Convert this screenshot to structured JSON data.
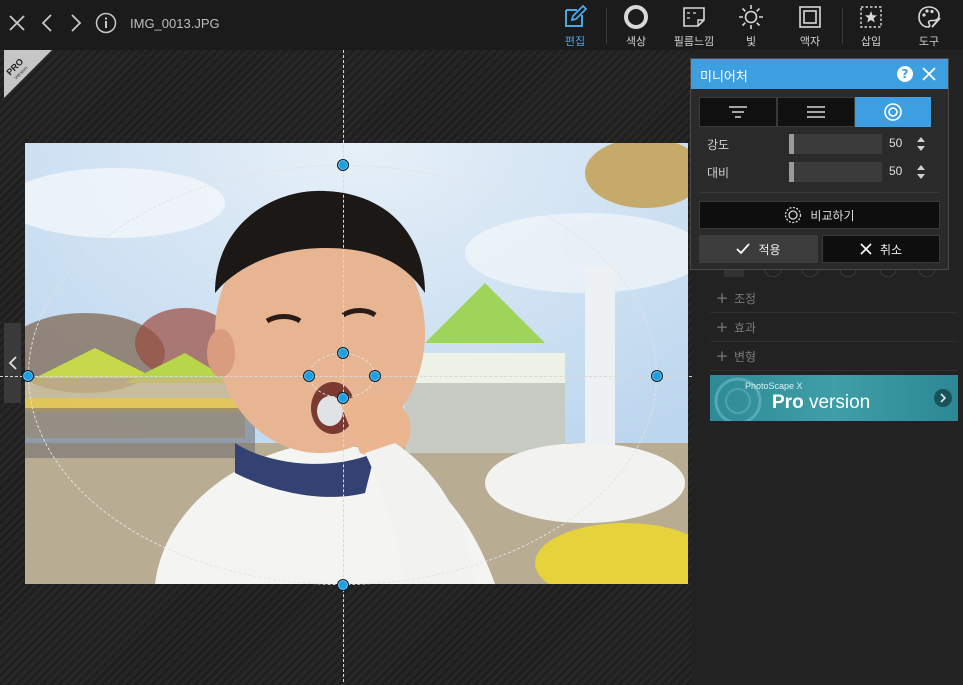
{
  "file": {
    "name": "IMG_0013.JPG"
  },
  "toolbar": {
    "tools": [
      {
        "label": "편집",
        "icon": "edit-icon"
      },
      {
        "label": "색상",
        "icon": "circle-icon"
      },
      {
        "label": "필름느낌",
        "icon": "film-icon"
      },
      {
        "label": "빛",
        "icon": "sun-icon"
      },
      {
        "label": "액자",
        "icon": "frame-icon"
      },
      {
        "label": "삽입",
        "icon": "insert-icon"
      },
      {
        "label": "도구",
        "icon": "palette-icon"
      }
    ],
    "active": "편집",
    "accent_color": "#4aa7e6"
  },
  "canvas": {
    "badge": {
      "line1": "PRO",
      "line2": "Version"
    }
  },
  "dialog": {
    "title": "미니어처",
    "help": "?",
    "modes": [
      "linear-mode-icon",
      "bars-mode-icon",
      "radial-mode-icon"
    ],
    "active_mode": 2,
    "sliders": [
      {
        "label": "강도",
        "value": "50",
        "level": 0.5
      },
      {
        "label": "대비",
        "value": "50",
        "level": 0.5
      }
    ],
    "compare_label": "비교하기",
    "apply_label": "적용",
    "cancel_label": "취소",
    "title_color": "#3d9fdf"
  },
  "panel": {
    "sections": [
      "조정",
      "효과",
      "변형"
    ],
    "banner": {
      "small": "PhotoScape X",
      "pro": "Pro",
      "version": " version"
    }
  }
}
